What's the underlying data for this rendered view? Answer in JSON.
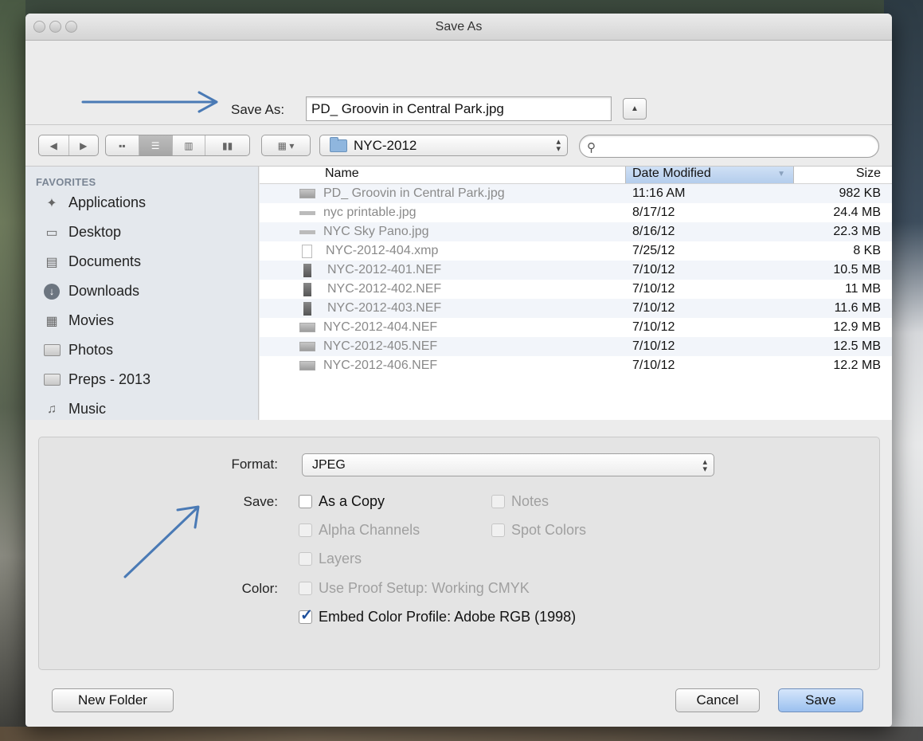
{
  "window": {
    "title": "Save As"
  },
  "save_as": {
    "label": "Save As:",
    "filename": "PD_ Groovin in Central Park.jpg",
    "expand_glyph": "▲"
  },
  "toolbar": {
    "back_glyph": "◀",
    "forward_glyph": "▶",
    "view_icons": [
      "icon-view",
      "list-view",
      "column-view",
      "coverflow-view"
    ],
    "arrange_glyph": "▾",
    "path_folder": "NYC-2012",
    "search_placeholder": ""
  },
  "sidebar": {
    "header": "FAVORITES",
    "items": [
      {
        "label": "Applications",
        "icon": "applications-icon"
      },
      {
        "label": "Desktop",
        "icon": "desktop-icon"
      },
      {
        "label": "Documents",
        "icon": "documents-icon"
      },
      {
        "label": "Downloads",
        "icon": "downloads-icon"
      },
      {
        "label": "Movies",
        "icon": "movies-icon"
      },
      {
        "label": "Photos",
        "icon": "folder-icon"
      },
      {
        "label": "Preps - 2013",
        "icon": "folder-icon"
      },
      {
        "label": "Music",
        "icon": "music-icon"
      }
    ]
  },
  "files": {
    "columns": {
      "name": "Name",
      "date": "Date Modified",
      "size": "Size"
    },
    "rows": [
      {
        "name": "PD_ Groovin in Central Park.jpg",
        "date": "11:16 AM",
        "size": "982 KB",
        "icon": "img"
      },
      {
        "name": "nyc printable.jpg",
        "date": "8/17/12",
        "size": "24.4 MB",
        "icon": "pano"
      },
      {
        "name": "NYC Sky Pano.jpg",
        "date": "8/16/12",
        "size": "22.3 MB",
        "icon": "pano"
      },
      {
        "name": "NYC-2012-404.xmp",
        "date": "7/25/12",
        "size": "8 KB",
        "icon": "doc"
      },
      {
        "name": "NYC-2012-401.NEF",
        "date": "7/10/12",
        "size": "10.5 MB",
        "icon": "nef"
      },
      {
        "name": "NYC-2012-402.NEF",
        "date": "7/10/12",
        "size": "11 MB",
        "icon": "nef"
      },
      {
        "name": "NYC-2012-403.NEF",
        "date": "7/10/12",
        "size": "11.6 MB",
        "icon": "nef"
      },
      {
        "name": "NYC-2012-404.NEF",
        "date": "7/10/12",
        "size": "12.9 MB",
        "icon": "img"
      },
      {
        "name": "NYC-2012-405.NEF",
        "date": "7/10/12",
        "size": "12.5 MB",
        "icon": "img"
      },
      {
        "name": "NYC-2012-406.NEF",
        "date": "7/10/12",
        "size": "12.2 MB",
        "icon": "img"
      }
    ]
  },
  "options": {
    "format_label": "Format:",
    "format_value": "JPEG",
    "save_label": "Save:",
    "color_label": "Color:",
    "checkboxes": {
      "as_copy": "As a Copy",
      "notes": "Notes",
      "alpha": "Alpha Channels",
      "spot": "Spot Colors",
      "layers": "Layers",
      "proof": "Use Proof Setup:  Working CMYK",
      "embed": "Embed Color Profile:  Adobe RGB (1998)"
    },
    "embed_checked": true
  },
  "buttons": {
    "new_folder": "New Folder",
    "cancel": "Cancel",
    "save": "Save"
  },
  "colors": {
    "accent": "#9bc0ef",
    "annotation_arrow": "#4a7ab5"
  }
}
